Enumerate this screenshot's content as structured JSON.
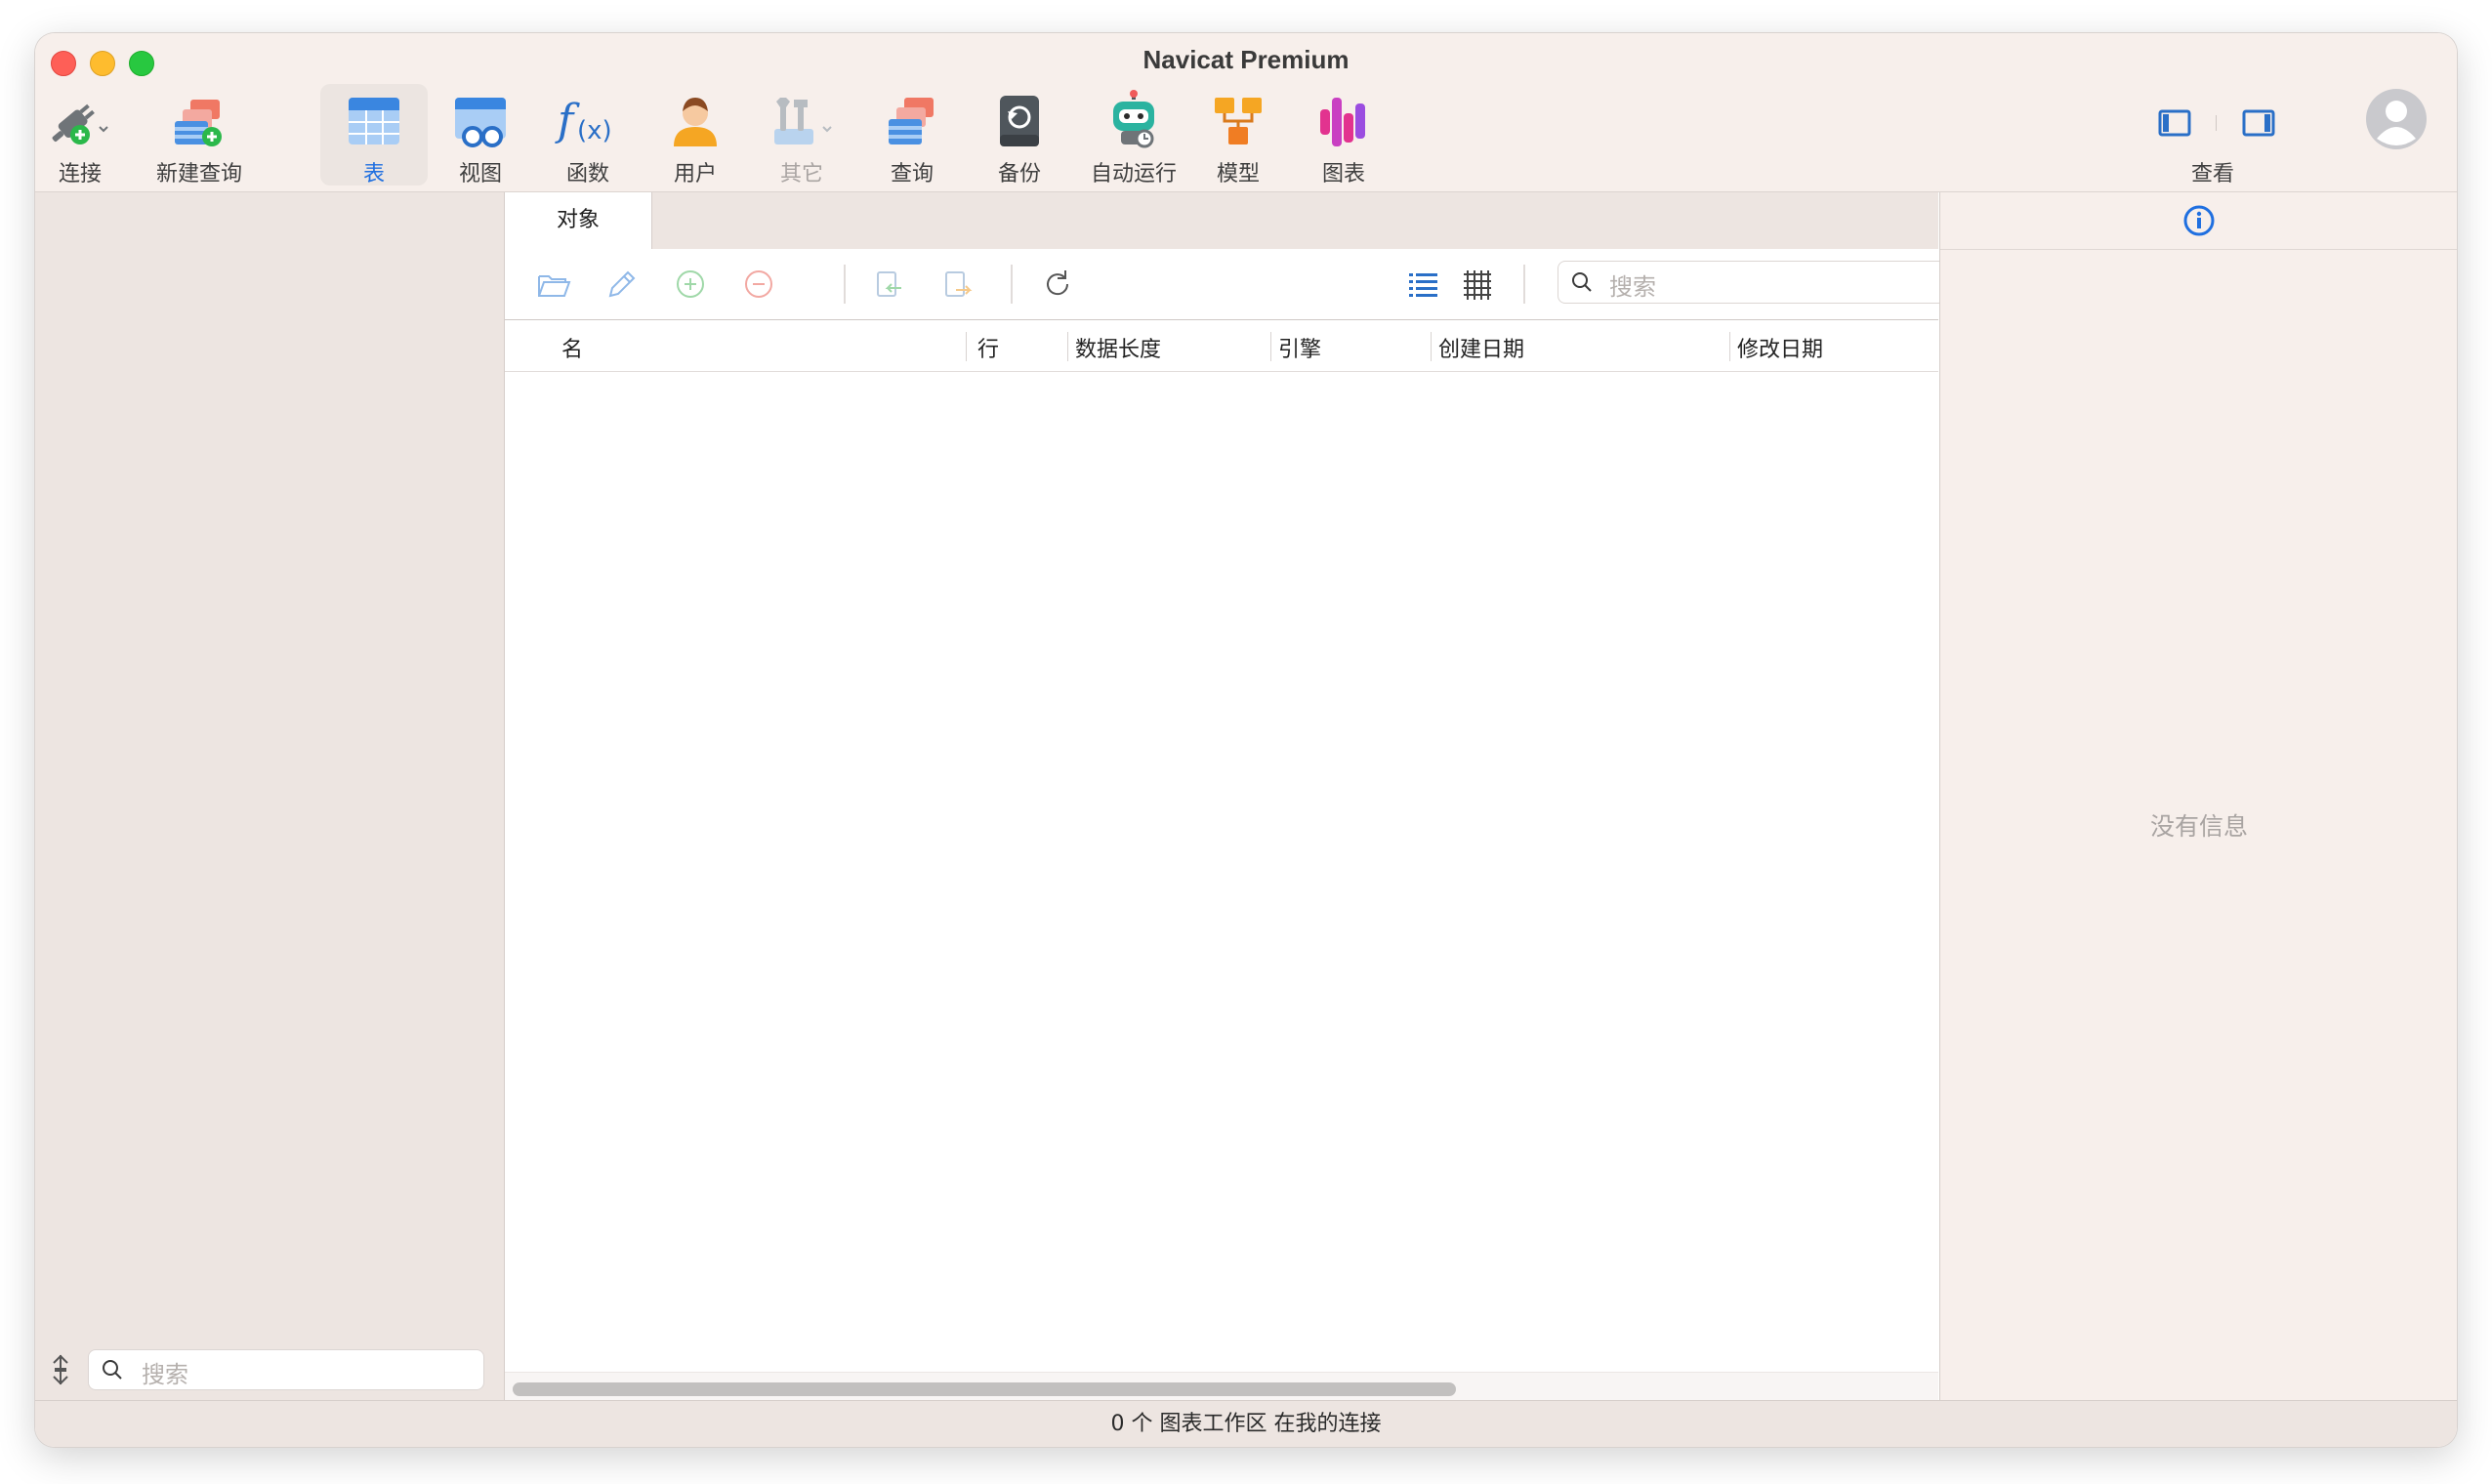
{
  "window": {
    "title": "Navicat Premium"
  },
  "toolbar": {
    "connect": "连接",
    "new_query": "新建查询",
    "table": "表",
    "view": "视图",
    "function": "函数",
    "user": "用户",
    "other": "其它",
    "query": "查询",
    "backup": "备份",
    "automation": "自动运行",
    "model": "模型",
    "chart": "图表",
    "view_toggle": "查看"
  },
  "sidebar": {
    "search_placeholder": "搜索"
  },
  "main": {
    "tabs": [
      {
        "label": "对象"
      }
    ],
    "search_placeholder": "搜索",
    "columns": [
      "名",
      "行",
      "数据长度",
      "引擎",
      "创建日期",
      "修改日期"
    ]
  },
  "info_panel": {
    "empty_text": "没有信息"
  },
  "status": {
    "text": "0 个 图表工作区 在我的连接"
  },
  "colors": {
    "accent": "#1f6fe0",
    "titlebar": "#f7efeb",
    "sidebar": "#ede5e1"
  }
}
